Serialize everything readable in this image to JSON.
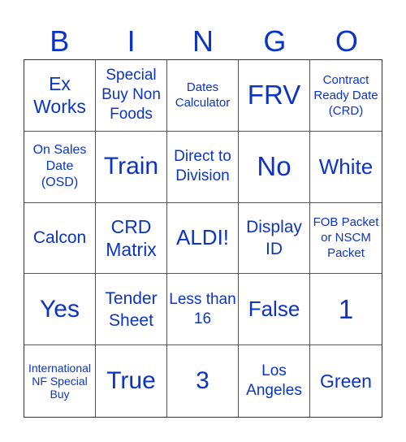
{
  "header": [
    "B",
    "I",
    "N",
    "G",
    "O"
  ],
  "colors": {
    "text": "#0b34c4",
    "grid": "#555555"
  },
  "cells": [
    "Ex Works",
    "Special Buy Non Foods",
    "Dates Calculator",
    "FRV",
    "Contract Ready Date (CRD)",
    "On Sales Date (OSD)",
    "Train",
    "Direct to Division",
    "No",
    "White",
    "Calcon",
    "CRD Matrix",
    "ALDI!",
    "Display ID",
    "FOB Packet or NSCM Packet",
    "Yes",
    "Tender Sheet",
    "Less than 16",
    "False",
    "1",
    "International NF Special Buy",
    "True",
    "3",
    "Los Angeles",
    "Green"
  ]
}
